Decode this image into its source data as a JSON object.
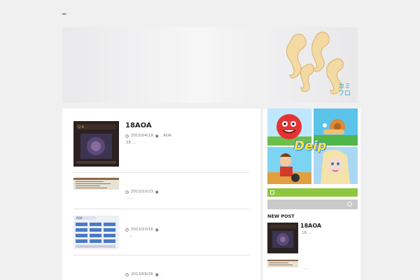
{
  "site": {
    "title": "_",
    "logo_text": "カミフロ"
  },
  "posts": [
    {
      "title": "18AOA",
      "date": "2015/04/19",
      "tags": ". AOA",
      "excerpt": "18 ..."
    },
    {
      "title": "",
      "date": "2013/10/23",
      "tags": "",
      "excerpt": "..."
    },
    {
      "title": "",
      "date": "2013/10/16",
      "tags": "",
      "excerpt": "..."
    },
    {
      "title": "",
      "date": "2013/09/26",
      "tags": ".",
      "excerpt": ""
    }
  ],
  "sidebar": {
    "ad_word": "Deip",
    "new_post_heading": "NEW POST",
    "recent": [
      {
        "title": "18AOA",
        "excerpt": "18 ..."
      },
      {
        "title": "",
        "excerpt": "..."
      }
    ]
  },
  "icons": {
    "clock": "clock-icon",
    "tag": "tag-icon",
    "rss": "rss-icon",
    "search": "search-icon"
  },
  "colors": {
    "rss_bar": "#8dc63f",
    "search_bar": "#c9c9c9",
    "logo_text": "#3aa0c8"
  }
}
